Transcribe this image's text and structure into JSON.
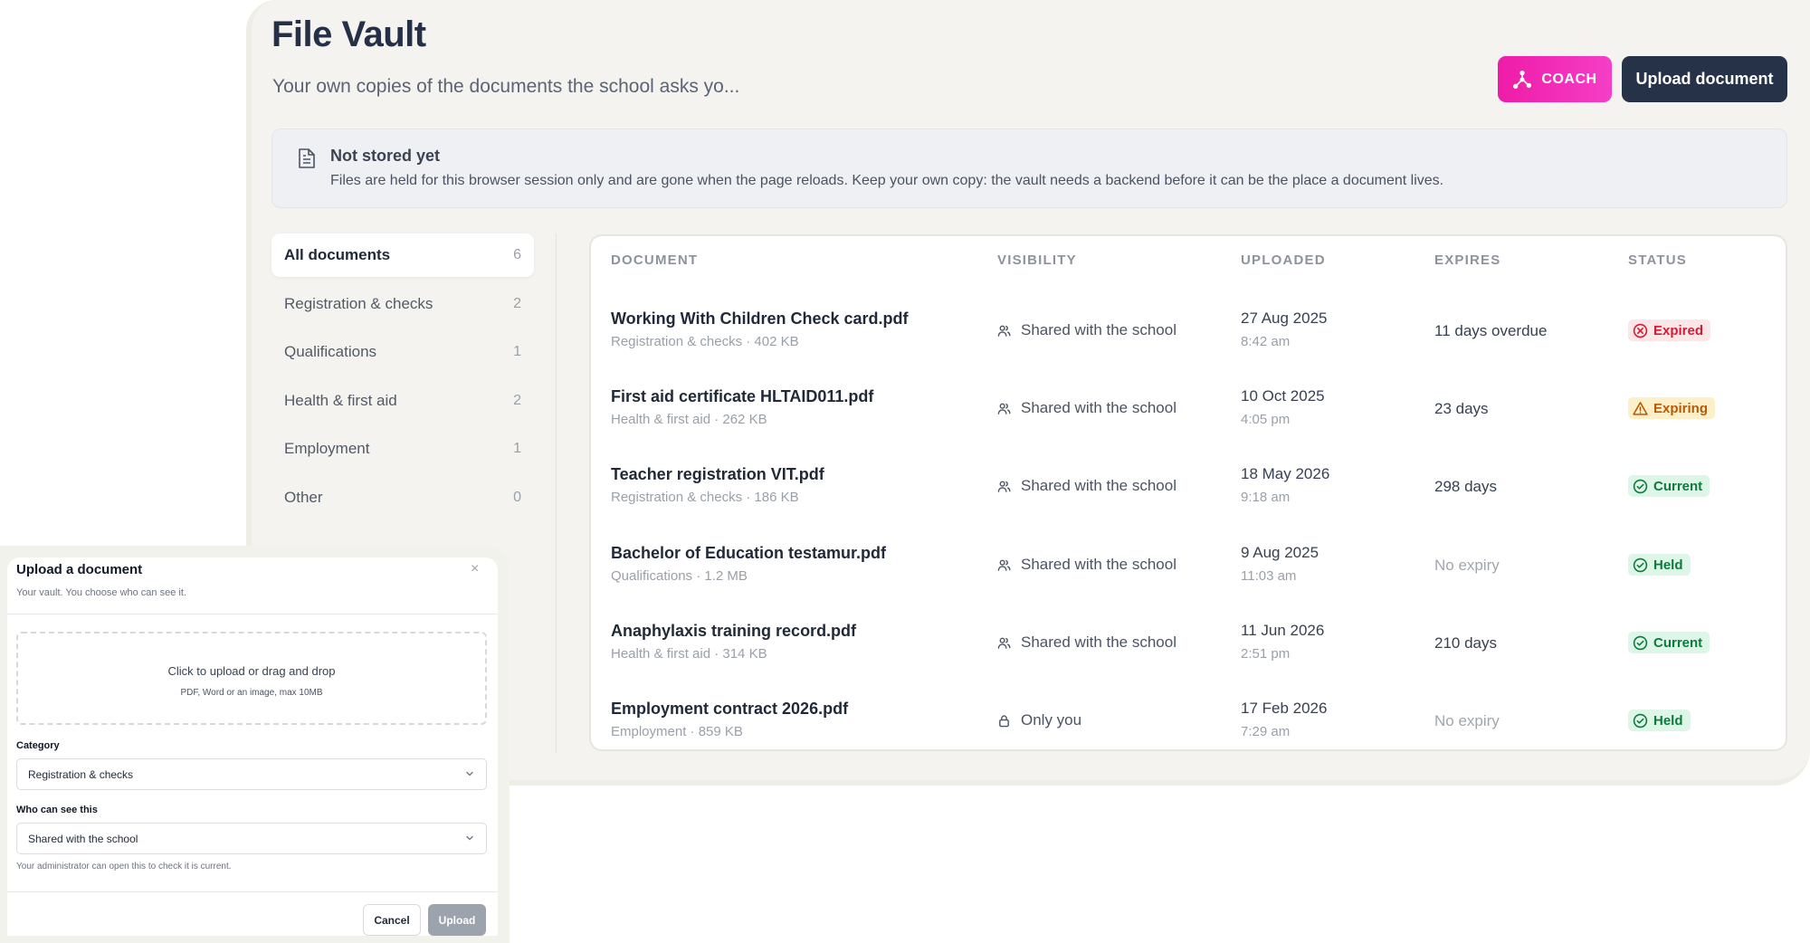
{
  "header": {
    "title": "File Vault",
    "subtitle": "Your own copies of the documents the school asks yo...",
    "coach_label": "COACH",
    "upload_label": "Upload document"
  },
  "notice": {
    "title": "Not stored yet",
    "text": "Files are held for this browser session only and are gone when the page reloads. Keep your own copy: the vault needs a backend before it can be the place a document lives."
  },
  "sidebar": {
    "items": [
      {
        "label": "All documents",
        "count": "6"
      },
      {
        "label": "Registration & checks",
        "count": "2"
      },
      {
        "label": "Qualifications",
        "count": "1"
      },
      {
        "label": "Health & first aid",
        "count": "2"
      },
      {
        "label": "Employment",
        "count": "1"
      },
      {
        "label": "Other",
        "count": "0"
      }
    ]
  },
  "table": {
    "headers": [
      "DOCUMENT",
      "VISIBILITY",
      "UPLOADED",
      "EXPIRES",
      "STATUS"
    ],
    "rows": [
      {
        "name": "Working With Children Check card.pdf",
        "meta": "Registration & checks · 402 KB",
        "visibility": "Shared with the school",
        "date": "27 Aug 2025",
        "time": "8:42 am",
        "expires": "11 days overdue",
        "status": "Expired"
      },
      {
        "name": "First aid certificate HLTAID011.pdf",
        "meta": "Health & first aid · 262 KB",
        "visibility": "Shared with the school",
        "date": "10 Oct 2025",
        "time": "4:05 pm",
        "expires": "23 days",
        "status": "Expiring"
      },
      {
        "name": "Teacher registration VIT.pdf",
        "meta": "Registration & checks · 186 KB",
        "visibility": "Shared with the school",
        "date": "18 May 2026",
        "time": "9:18 am",
        "expires": "298 days",
        "status": "Current"
      },
      {
        "name": "Bachelor of Education testamur.pdf",
        "meta": "Qualifications · 1.2 MB",
        "visibility": "Shared with the school",
        "date": "9 Aug 2025",
        "time": "11:03 am",
        "expires": "No expiry",
        "status": "Held"
      },
      {
        "name": "Anaphylaxis training record.pdf",
        "meta": "Health & first aid · 314 KB",
        "visibility": "Shared with the school",
        "date": "11 Jun 2026",
        "time": "2:51 pm",
        "expires": "210 days",
        "status": "Current"
      },
      {
        "name": "Employment contract 2026.pdf",
        "meta": "Employment · 859 KB",
        "visibility": "Only you",
        "date": "17 Feb 2026",
        "time": "7:29 am",
        "expires": "No expiry",
        "status": "Held"
      }
    ]
  },
  "modal": {
    "title": "Upload a document",
    "subtitle": "Your vault. You choose who can see it.",
    "close": "×",
    "dropzone_main": "Click to upload or drag and drop",
    "dropzone_sub": "PDF, Word or an image, max 10MB",
    "category_label": "Category",
    "category_value": "Registration & checks",
    "visibility_label": "Who can see this",
    "visibility_value": "Shared with the school",
    "helper": "Your administrator can open this to check it is current.",
    "cancel": "Cancel",
    "upload": "Upload"
  },
  "colors": {
    "coach_pink": "#ee1ca8",
    "primary_navy": "#263247",
    "expired_red": "#d21c35",
    "expiring_amber": "#b45a08",
    "ok_green": "#0f7a3e"
  },
  "icons": {
    "coach": "network-nodes-icon",
    "notice": "document-icon",
    "shared": "people-icon",
    "private": "lock-icon",
    "expired": "x-circle-icon",
    "expiring": "warning-triangle-icon",
    "current": "check-circle-icon",
    "held": "check-circle-icon",
    "dropdown": "chevron-down-icon",
    "close": "close-icon"
  }
}
